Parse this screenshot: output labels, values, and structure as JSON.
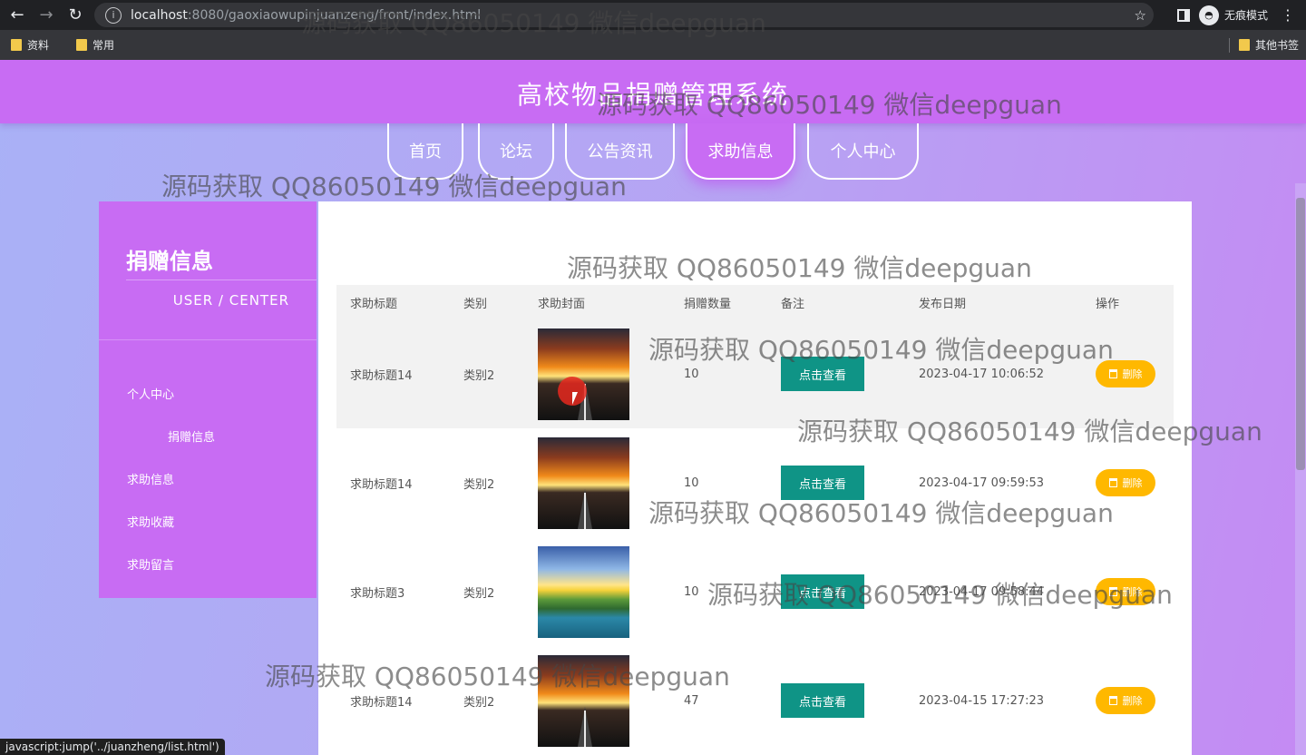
{
  "browser": {
    "url_host": "localhost",
    "url_path": ":8080/gaoxiaowupinjuanzeng/front/index.html",
    "incognito_label": "无痕模式",
    "bookmarks": [
      "资料",
      "常用"
    ],
    "other_bookmarks": "其他书签",
    "status_text": "javascript:jump('../juanzheng/list.html')"
  },
  "header": {
    "title": "高校物品捐赠管理系统"
  },
  "nav": {
    "items": [
      {
        "label": "首页"
      },
      {
        "label": "论坛"
      },
      {
        "label": "公告资讯"
      },
      {
        "label": "求助信息"
      },
      {
        "label": "个人中心"
      }
    ],
    "active": "求助信息"
  },
  "sidebar": {
    "title": "捐赠信息",
    "subtitle": "USER / CENTER",
    "items": [
      {
        "label": "个人中心"
      },
      {
        "label": "捐赠信息"
      },
      {
        "label": "求助信息"
      },
      {
        "label": "求助收藏"
      },
      {
        "label": "求助留言"
      }
    ]
  },
  "table": {
    "headers": [
      "求助标题",
      "类别",
      "求助封面",
      "捐赠数量",
      "备注",
      "发布日期",
      "操作"
    ],
    "view_label": "点击查看",
    "delete_label": "删除",
    "rows": [
      {
        "title": "求助标题14",
        "category": "类别2",
        "cover": "sunset-road",
        "qty": "10",
        "date": "2023-04-17 10:06:52"
      },
      {
        "title": "求助标题14",
        "category": "类别2",
        "cover": "sunset-road",
        "qty": "10",
        "date": "2023-04-17 09:59:53"
      },
      {
        "title": "求助标题3",
        "category": "类别2",
        "cover": "lake-sunrise",
        "qty": "10",
        "date": "2023-04-17 09:58:44"
      },
      {
        "title": "求助标题14",
        "category": "类别2",
        "cover": "sunset-road",
        "qty": "47",
        "date": "2023-04-15 17:27:23"
      }
    ]
  },
  "watermark": "源码获取 QQ86050149 微信deepguan",
  "colors": {
    "header": "#c86cf3",
    "view_button": "#0f9486",
    "delete_button": "#ffb800"
  }
}
